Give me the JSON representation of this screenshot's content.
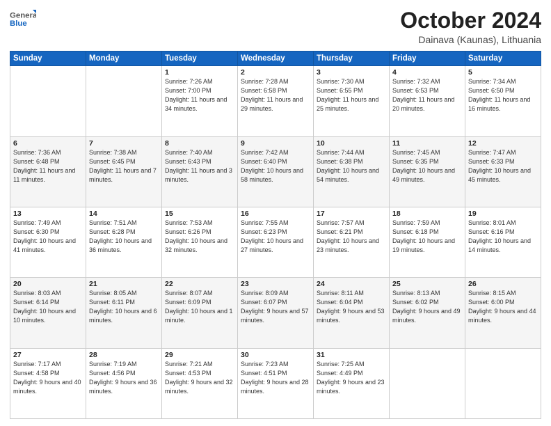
{
  "header": {
    "logo_general": "General",
    "logo_blue": "Blue",
    "title": "October 2024",
    "subtitle": "Dainava (Kaunas), Lithuania"
  },
  "days_of_week": [
    "Sunday",
    "Monday",
    "Tuesday",
    "Wednesday",
    "Thursday",
    "Friday",
    "Saturday"
  ],
  "weeks": [
    [
      {
        "day": "",
        "info": ""
      },
      {
        "day": "",
        "info": ""
      },
      {
        "day": "1",
        "info": "Sunrise: 7:26 AM\nSunset: 7:00 PM\nDaylight: 11 hours\nand 34 minutes."
      },
      {
        "day": "2",
        "info": "Sunrise: 7:28 AM\nSunset: 6:58 PM\nDaylight: 11 hours\nand 29 minutes."
      },
      {
        "day": "3",
        "info": "Sunrise: 7:30 AM\nSunset: 6:55 PM\nDaylight: 11 hours\nand 25 minutes."
      },
      {
        "day": "4",
        "info": "Sunrise: 7:32 AM\nSunset: 6:53 PM\nDaylight: 11 hours\nand 20 minutes."
      },
      {
        "day": "5",
        "info": "Sunrise: 7:34 AM\nSunset: 6:50 PM\nDaylight: 11 hours\nand 16 minutes."
      }
    ],
    [
      {
        "day": "6",
        "info": "Sunrise: 7:36 AM\nSunset: 6:48 PM\nDaylight: 11 hours\nand 11 minutes."
      },
      {
        "day": "7",
        "info": "Sunrise: 7:38 AM\nSunset: 6:45 PM\nDaylight: 11 hours\nand 7 minutes."
      },
      {
        "day": "8",
        "info": "Sunrise: 7:40 AM\nSunset: 6:43 PM\nDaylight: 11 hours\nand 3 minutes."
      },
      {
        "day": "9",
        "info": "Sunrise: 7:42 AM\nSunset: 6:40 PM\nDaylight: 10 hours\nand 58 minutes."
      },
      {
        "day": "10",
        "info": "Sunrise: 7:44 AM\nSunset: 6:38 PM\nDaylight: 10 hours\nand 54 minutes."
      },
      {
        "day": "11",
        "info": "Sunrise: 7:45 AM\nSunset: 6:35 PM\nDaylight: 10 hours\nand 49 minutes."
      },
      {
        "day": "12",
        "info": "Sunrise: 7:47 AM\nSunset: 6:33 PM\nDaylight: 10 hours\nand 45 minutes."
      }
    ],
    [
      {
        "day": "13",
        "info": "Sunrise: 7:49 AM\nSunset: 6:30 PM\nDaylight: 10 hours\nand 41 minutes."
      },
      {
        "day": "14",
        "info": "Sunrise: 7:51 AM\nSunset: 6:28 PM\nDaylight: 10 hours\nand 36 minutes."
      },
      {
        "day": "15",
        "info": "Sunrise: 7:53 AM\nSunset: 6:26 PM\nDaylight: 10 hours\nand 32 minutes."
      },
      {
        "day": "16",
        "info": "Sunrise: 7:55 AM\nSunset: 6:23 PM\nDaylight: 10 hours\nand 27 minutes."
      },
      {
        "day": "17",
        "info": "Sunrise: 7:57 AM\nSunset: 6:21 PM\nDaylight: 10 hours\nand 23 minutes."
      },
      {
        "day": "18",
        "info": "Sunrise: 7:59 AM\nSunset: 6:18 PM\nDaylight: 10 hours\nand 19 minutes."
      },
      {
        "day": "19",
        "info": "Sunrise: 8:01 AM\nSunset: 6:16 PM\nDaylight: 10 hours\nand 14 minutes."
      }
    ],
    [
      {
        "day": "20",
        "info": "Sunrise: 8:03 AM\nSunset: 6:14 PM\nDaylight: 10 hours\nand 10 minutes."
      },
      {
        "day": "21",
        "info": "Sunrise: 8:05 AM\nSunset: 6:11 PM\nDaylight: 10 hours\nand 6 minutes."
      },
      {
        "day": "22",
        "info": "Sunrise: 8:07 AM\nSunset: 6:09 PM\nDaylight: 10 hours\nand 1 minute."
      },
      {
        "day": "23",
        "info": "Sunrise: 8:09 AM\nSunset: 6:07 PM\nDaylight: 9 hours\nand 57 minutes."
      },
      {
        "day": "24",
        "info": "Sunrise: 8:11 AM\nSunset: 6:04 PM\nDaylight: 9 hours\nand 53 minutes."
      },
      {
        "day": "25",
        "info": "Sunrise: 8:13 AM\nSunset: 6:02 PM\nDaylight: 9 hours\nand 49 minutes."
      },
      {
        "day": "26",
        "info": "Sunrise: 8:15 AM\nSunset: 6:00 PM\nDaylight: 9 hours\nand 44 minutes."
      }
    ],
    [
      {
        "day": "27",
        "info": "Sunrise: 7:17 AM\nSunset: 4:58 PM\nDaylight: 9 hours\nand 40 minutes."
      },
      {
        "day": "28",
        "info": "Sunrise: 7:19 AM\nSunset: 4:56 PM\nDaylight: 9 hours\nand 36 minutes."
      },
      {
        "day": "29",
        "info": "Sunrise: 7:21 AM\nSunset: 4:53 PM\nDaylight: 9 hours\nand 32 minutes."
      },
      {
        "day": "30",
        "info": "Sunrise: 7:23 AM\nSunset: 4:51 PM\nDaylight: 9 hours\nand 28 minutes."
      },
      {
        "day": "31",
        "info": "Sunrise: 7:25 AM\nSunset: 4:49 PM\nDaylight: 9 hours\nand 23 minutes."
      },
      {
        "day": "",
        "info": ""
      },
      {
        "day": "",
        "info": ""
      }
    ]
  ]
}
